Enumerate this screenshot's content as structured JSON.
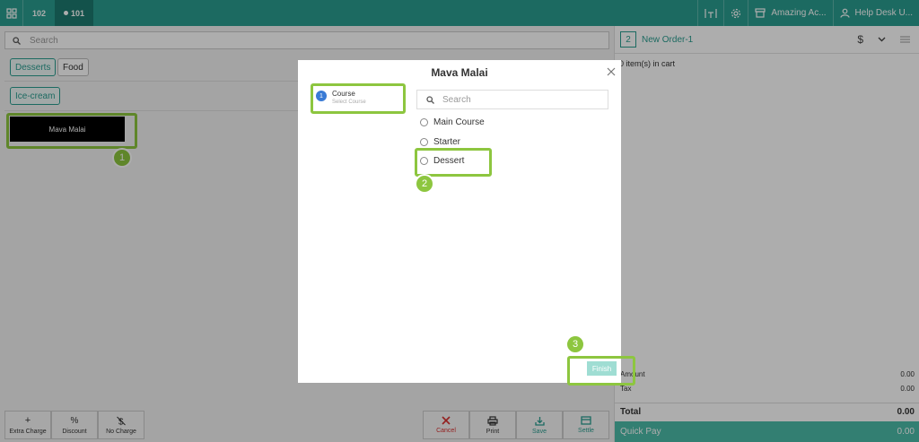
{
  "topbar": {
    "tabs": [
      {
        "label": "102"
      },
      {
        "label": "101"
      }
    ],
    "right_items": {
      "location_label": "Amazing Ac...",
      "user_label": "Help Desk U..."
    }
  },
  "left": {
    "search_placeholder": "Search",
    "categories": [
      "Desserts",
      "Food"
    ],
    "subcategory": "Ice-cream",
    "item_name": "Mava Malai",
    "bottom_actions": [
      "Extra Charge",
      "Discount",
      "No Charge"
    ],
    "bottom_actions_icons": [
      "plus-icon",
      "percent-icon",
      "no-dollar-icon"
    ],
    "order_actions": [
      "Cancel",
      "Print",
      "Save",
      "Settle"
    ],
    "order_actions_icons": [
      "close-icon",
      "printer-icon",
      "download-icon",
      "card-icon"
    ]
  },
  "right": {
    "order_number": "2",
    "order_title": "New Order-1",
    "cart_count": "0 item(s) in cart",
    "amount_label": "Amount",
    "amount_value": "0.00",
    "tax_label": "Tax",
    "tax_value": "0.00",
    "total_label": "Total",
    "total_value": "0.00",
    "quickpay_label": "Quick Pay",
    "quickpay_value": "0.00"
  },
  "modal": {
    "title": "Mava Malai",
    "step": {
      "number": "1",
      "title": "Course",
      "subtitle": "Select Course"
    },
    "search_placeholder": "Search",
    "options": [
      "Main Course",
      "Starter",
      "Dessert"
    ],
    "finish_label": "Finish"
  },
  "annotations": [
    "1",
    "2",
    "3"
  ],
  "colors": {
    "brand_teal": "#2a9d8f",
    "callout_green": "#8dc63f",
    "quickpay": "#4cbba9",
    "cancel_red": "#d9302f",
    "step_blue": "#3a7bd5"
  }
}
